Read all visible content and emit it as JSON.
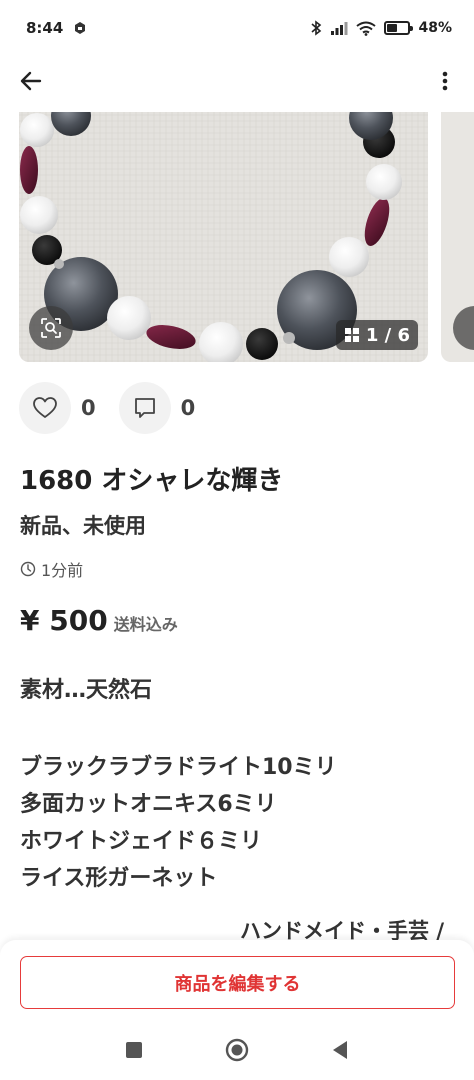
{
  "status_bar": {
    "time": "8:44",
    "battery": "48%",
    "battery_level": 0.48
  },
  "app_bar": {
    "back_icon": "arrow-left-icon",
    "menu_icon": "more-vertical-icon"
  },
  "gallery": {
    "counter": "1 / 6",
    "current": 1,
    "total": 6
  },
  "actions": {
    "likes": "0",
    "comments": "0"
  },
  "item": {
    "title": "1680 オシャレな輝き",
    "condition": "新品、未使用",
    "posted": "1分前",
    "price": "¥ 500",
    "shipping": "送料込み",
    "description": [
      "素材…天然石",
      "",
      "ブラックラブラドライト10ミリ",
      "多面カットオニキス6ミリ",
      "ホワイトジェイド６ミリ",
      "ライス形ガーネット"
    ],
    "category_peek": "ハンドメイド・手芸 /"
  },
  "bottom": {
    "edit_label": "商品を編集する"
  },
  "colors": {
    "accent": "#e03434",
    "text": "#222222",
    "muted": "#666666",
    "chip_bg": "#f2f2f2"
  }
}
